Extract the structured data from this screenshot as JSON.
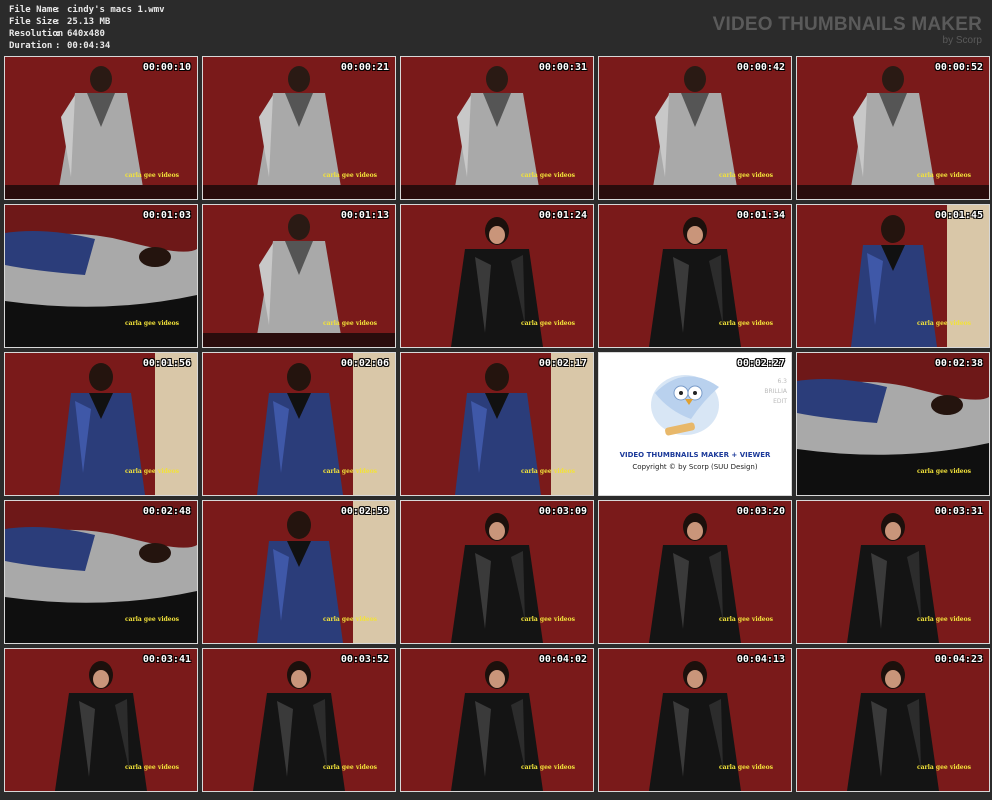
{
  "meta": {
    "rows": [
      {
        "label": "File Name",
        "sep": ":",
        "value": "cindy's macs 1.wmv"
      },
      {
        "label": "File Size",
        "sep": ":",
        "value": "25.13 MB"
      },
      {
        "label": "Resolution",
        "sep": ":",
        "value": "640x480"
      },
      {
        "label": "Duration",
        "sep": ":",
        "value": "00:04:34"
      }
    ]
  },
  "brand": {
    "title": "VIDEO THUMBNAILS MAKER",
    "subtitle": "by Scorp"
  },
  "watermark": "carla gee videos",
  "splash": {
    "line1": "VIDEO THUMBNAILS MAKER + VIEWER",
    "line2": "Copyright © by Scorp (SUU Design)",
    "side1": "6.3",
    "side2": "BRILLIA",
    "side3": "EDIT"
  },
  "thumbnails": [
    {
      "time": "00:00:10",
      "scene": "silver"
    },
    {
      "time": "00:00:21",
      "scene": "silver"
    },
    {
      "time": "00:00:31",
      "scene": "silver"
    },
    {
      "time": "00:00:42",
      "scene": "silver"
    },
    {
      "time": "00:00:52",
      "scene": "silver"
    },
    {
      "time": "00:01:03",
      "scene": "lying"
    },
    {
      "time": "00:01:13",
      "scene": "silver"
    },
    {
      "time": "00:01:24",
      "scene": "black"
    },
    {
      "time": "00:01:34",
      "scene": "black"
    },
    {
      "time": "00:01:45",
      "scene": "blue"
    },
    {
      "time": "00:01:56",
      "scene": "blue"
    },
    {
      "time": "00:02:06",
      "scene": "blue"
    },
    {
      "time": "00:02:17",
      "scene": "blue"
    },
    {
      "time": "00:02:27",
      "scene": "splash"
    },
    {
      "time": "00:02:38",
      "scene": "lying"
    },
    {
      "time": "00:02:48",
      "scene": "lying"
    },
    {
      "time": "00:02:59",
      "scene": "blue"
    },
    {
      "time": "00:03:09",
      "scene": "black"
    },
    {
      "time": "00:03:20",
      "scene": "black"
    },
    {
      "time": "00:03:31",
      "scene": "black"
    },
    {
      "time": "00:03:41",
      "scene": "black"
    },
    {
      "time": "00:03:52",
      "scene": "black"
    },
    {
      "time": "00:04:02",
      "scene": "black"
    },
    {
      "time": "00:04:13",
      "scene": "black"
    },
    {
      "time": "00:04:23",
      "scene": "black"
    }
  ],
  "colors": {
    "background": "#2b2b2b",
    "wall": "#7a1a1a",
    "silver": "#a9a9a9",
    "blue": "#2b3d7a",
    "black": "#141414",
    "watermark": "#f2e23a"
  }
}
